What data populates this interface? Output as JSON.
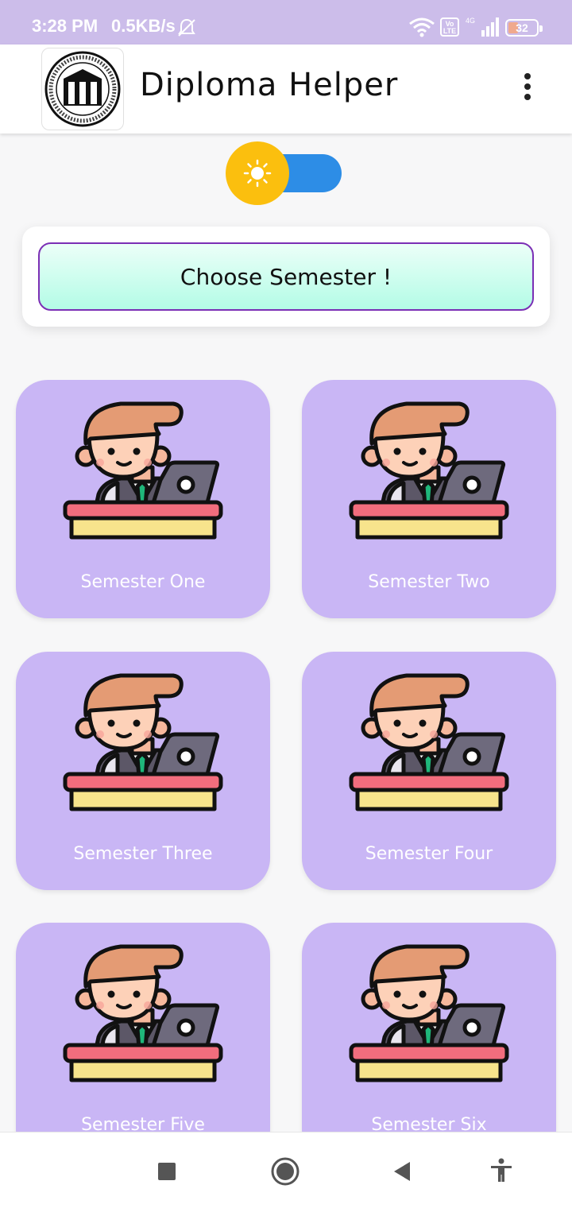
{
  "status_bar": {
    "time": "3:28 PM",
    "speed": "0.5KB/s",
    "volte": "Vo LTE",
    "network": "4G",
    "battery": "32"
  },
  "app_bar": {
    "title": "Diploma Helper",
    "logo_icon": "msbte-logo-icon",
    "menu_icon": "more-vert-icon"
  },
  "theme_toggle": {
    "state": "light",
    "colors": {
      "sun": "#fbbf0e",
      "moon_track": "#2d8de6"
    }
  },
  "choose_semester": {
    "label": "Choose Semester !"
  },
  "semesters": [
    {
      "label": "Semester One"
    },
    {
      "label": "Semester Two"
    },
    {
      "label": "Semester Three"
    },
    {
      "label": "Semester Four"
    },
    {
      "label": "Semester Five"
    },
    {
      "label": "Semester Six"
    }
  ],
  "colors": {
    "status_bar": "#ccbdea",
    "card_bg": "#c9b6f5",
    "button_border": "#7b2fb5",
    "button_gradient_end": "#b3fce6"
  },
  "nav_bar": {
    "icons": [
      "recents-square-icon",
      "home-circle-icon",
      "back-triangle-icon",
      "accessibility-icon"
    ]
  }
}
